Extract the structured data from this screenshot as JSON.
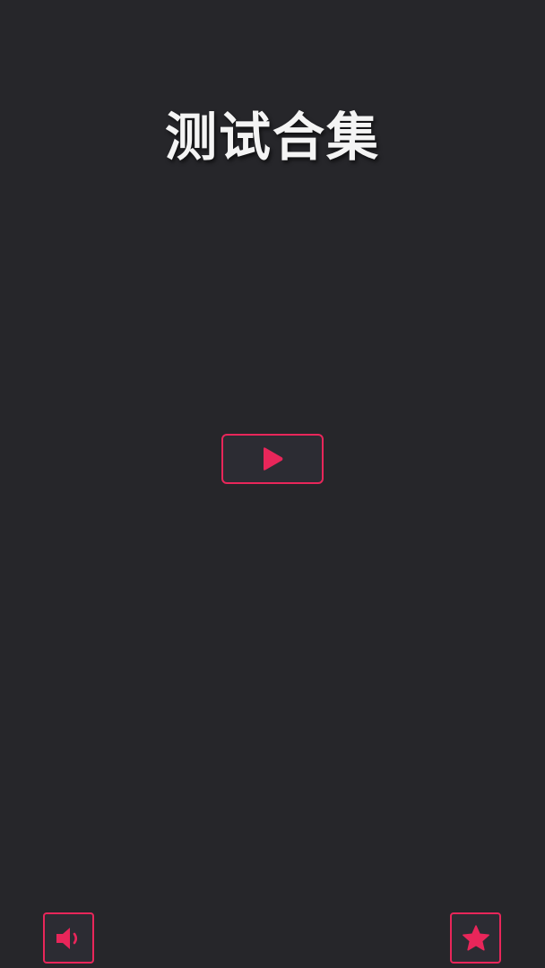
{
  "app": {
    "title": "测试合集"
  },
  "controls": {
    "play": {
      "icon": "play-icon"
    },
    "sound": {
      "icon": "speaker-icon"
    },
    "favorite": {
      "icon": "star-icon"
    }
  },
  "colors": {
    "background": "#26262a",
    "accent": "#e8265a",
    "title_text": "#f4f4f4",
    "button_fill": "#2c2c33"
  }
}
